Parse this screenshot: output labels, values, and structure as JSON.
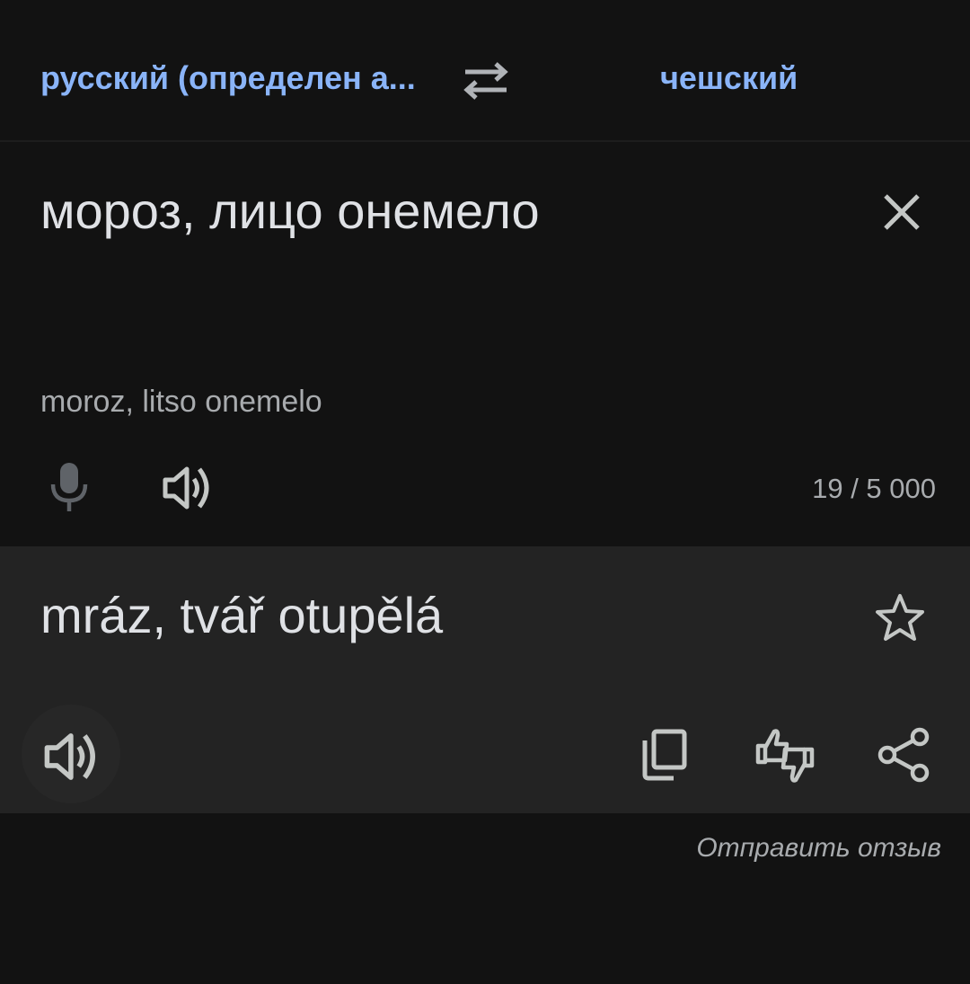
{
  "languages": {
    "source_label": "русский (определен а...",
    "target_label": "чешский"
  },
  "source": {
    "text": "мороз, лицо онемело",
    "transliteration": "moroz, litso onemelo",
    "char_count": "19 / 5 000"
  },
  "translation": {
    "text": "mráz, tvář otupělá"
  },
  "footer": {
    "feedback_link": "Отправить отзыв"
  },
  "colors": {
    "background": "#121212",
    "translation_panel": "#232323",
    "accent": "#8ab4f8",
    "text_primary": "#dfe1e5",
    "text_secondary": "#a8abae"
  },
  "icons": {
    "swap": "swap-horiz-icon",
    "clear": "close-icon",
    "mic": "mic-icon",
    "speaker": "volume-up-icon",
    "star": "star-outline-icon",
    "copy": "copy-icon",
    "feedback": "thumbs-up-down-icon",
    "share": "share-icon"
  }
}
